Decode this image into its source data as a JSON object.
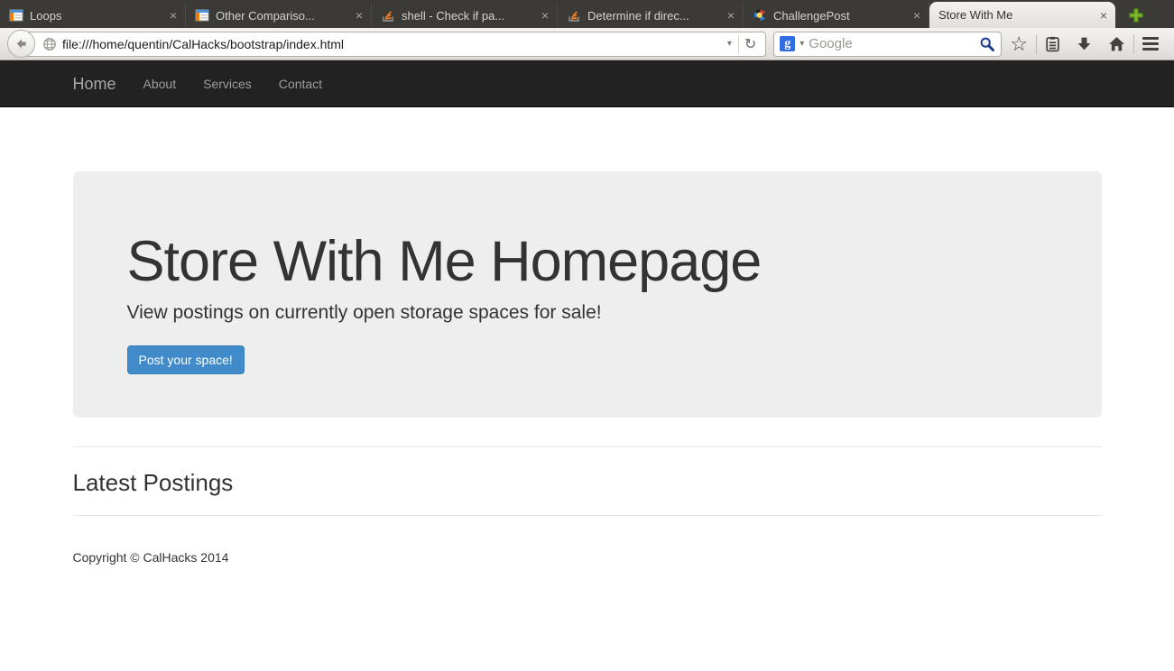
{
  "browser": {
    "tabs": [
      {
        "title": "Loops",
        "icon": "webpage-icon",
        "active": false
      },
      {
        "title": "Other Compariso...",
        "icon": "webpage-icon",
        "active": false
      },
      {
        "title": "shell - Check if pa...",
        "icon": "stackoverflow-icon",
        "active": false
      },
      {
        "title": "Determine if direc...",
        "icon": "stackoverflow-icon",
        "active": false
      },
      {
        "title": "ChallengePost",
        "icon": "challengepost-icon",
        "active": false
      },
      {
        "title": "Store With Me",
        "icon": "none",
        "active": true
      }
    ],
    "tab_close_glyph": "×",
    "url": "file:///home/quentin/CalHacks/bootstrap/index.html",
    "url_dropdown_glyph": "▾",
    "reload_glyph": "↻",
    "search": {
      "engine": "Google",
      "placeholder": "Google",
      "badge_glyph": "g",
      "dropdown_glyph": "▾"
    },
    "bookmark_star_glyph": "☆"
  },
  "page": {
    "navbar": {
      "brand": "Home",
      "links": [
        "About",
        "Services",
        "Contact"
      ]
    },
    "jumbotron": {
      "title": "Store With Me Homepage",
      "subtitle": "View postings on currently open storage spaces for sale!",
      "button_label": "Post your space!"
    },
    "latest_postings_heading": "Latest Postings",
    "footer": "Copyright © CalHacks 2014"
  },
  "colors": {
    "navbar_bg": "#222222",
    "jumbotron_bg": "#eeeeee",
    "button_bg": "#428bca",
    "button_border": "#357ebd",
    "tabbar_bg": "#3b3a36",
    "newtab_green": "#7cb82f",
    "google_badge_blue": "#2f6de1"
  }
}
